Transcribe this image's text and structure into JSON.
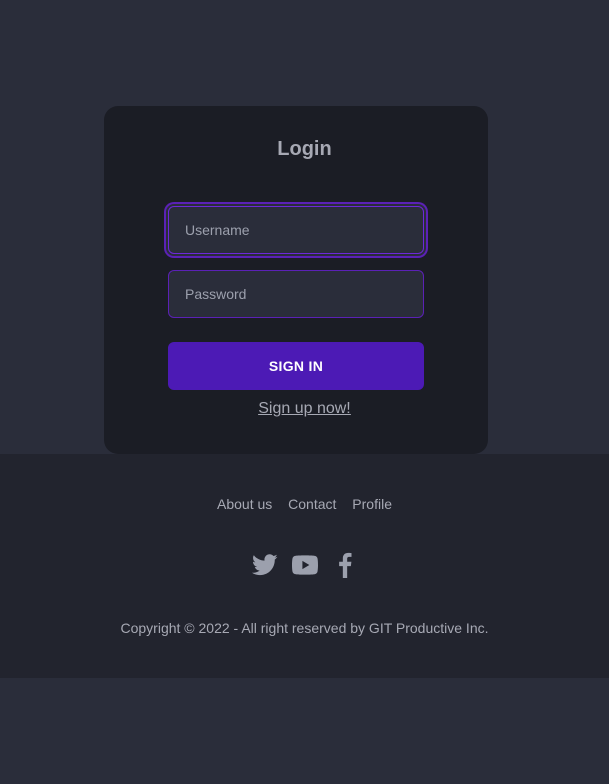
{
  "login": {
    "title": "Login",
    "username_placeholder": "Username",
    "password_placeholder": "Password",
    "signin_label": "SIGN IN",
    "signup_label": "Sign up now!"
  },
  "footer": {
    "nav": [
      "About us",
      "Contact",
      "Profile"
    ],
    "social_icons": [
      "twitter-icon",
      "youtube-icon",
      "facebook-icon"
    ],
    "copyright": "Copyright © 2022 - All right reserved by GIT Productive Inc."
  },
  "colors": {
    "page_bg": "#2a2d3a",
    "card_bg": "#1b1d25",
    "footer_bg": "#22242e",
    "accent": "#4c1ab5",
    "text_muted": "#a7a9b4"
  }
}
